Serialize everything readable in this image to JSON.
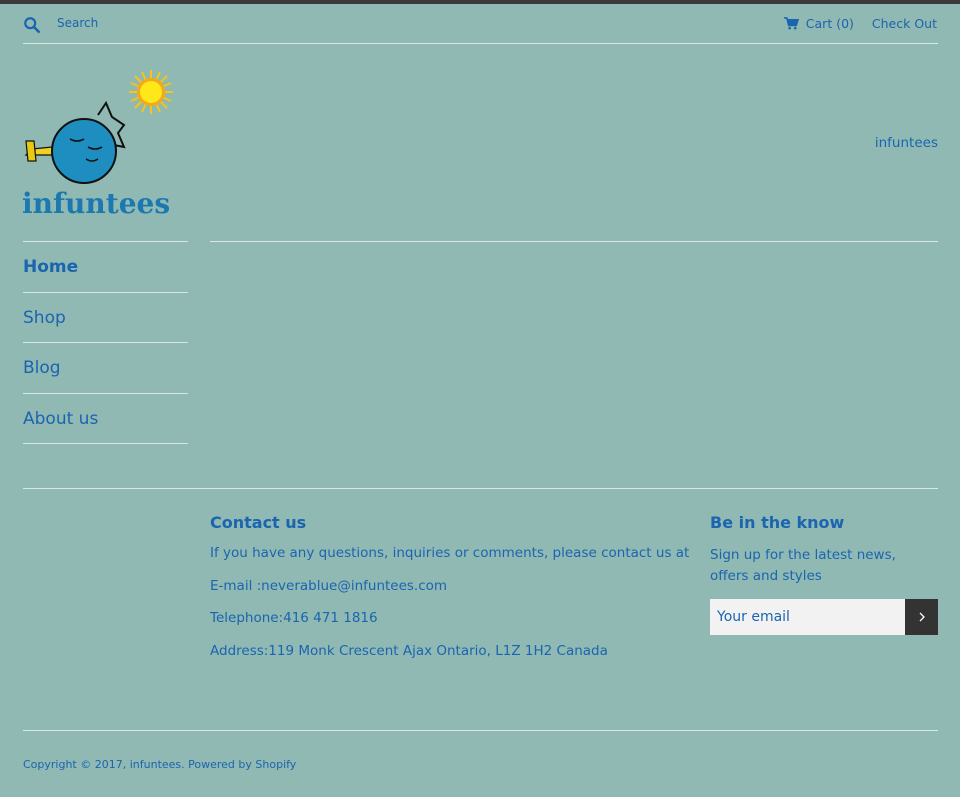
{
  "header": {
    "search_placeholder": "Search",
    "cart_label": "Cart (0)",
    "checkout_label": "Check Out",
    "shop_name": "infuntees"
  },
  "logo": {
    "text": "infuntees"
  },
  "nav": {
    "items": [
      {
        "label": "Home",
        "active": true
      },
      {
        "label": "Shop"
      },
      {
        "label": "Blog"
      },
      {
        "label": "About us"
      }
    ]
  },
  "footer": {
    "contact": {
      "title": "Contact us",
      "lines": [
        "If you have any questions, inquiries or comments, please contact us at",
        "E-mail :neverablue@infuntees.com",
        "Telephone:416 471 1816",
        "Address:119 Monk Crescent Ajax Ontario, L1Z 1H2 Canada"
      ]
    },
    "newsletter": {
      "title": "Be in the know",
      "text": "Sign up for the latest news, offers and styles",
      "email_placeholder": "Your email"
    },
    "copyright": "Copyright © 2017, infuntees. Powered by Shopify"
  },
  "colors": {
    "background": "#8fb9b2",
    "text": "#1b64b0",
    "divider": "#d8e8e4",
    "button": "#333333"
  }
}
